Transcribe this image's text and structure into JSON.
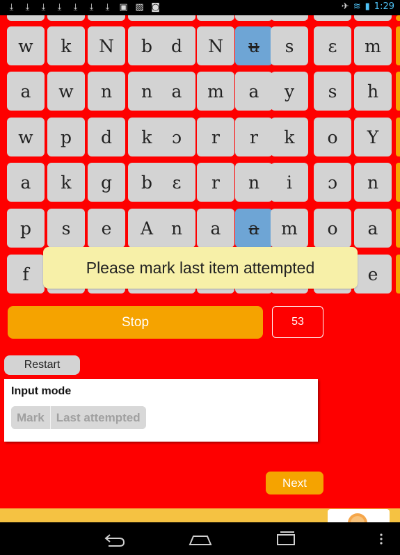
{
  "status_bar": {
    "time": "1:29",
    "left_icons": [
      "download-icon",
      "download-icon",
      "download-icon",
      "download-icon",
      "download-icon",
      "download-icon",
      "download-icon",
      "clipboard-icon",
      "gallery-icon",
      "camera-icon"
    ],
    "right_icons": [
      "bluetooth-icon",
      "wifi-icon",
      "battery-icon"
    ]
  },
  "grid": {
    "rows": [
      [
        "w",
        "k",
        "N",
        "b",
        "d",
        "N",
        "ʉ",
        "s",
        "ɛ",
        "m"
      ],
      [
        "a",
        "w",
        "n",
        "n",
        "a",
        "m",
        "a",
        "y",
        "s",
        "h"
      ],
      [
        "w",
        "p",
        "d",
        "k",
        "ɔ",
        "r",
        "r",
        "k",
        "o",
        "Y"
      ],
      [
        "a",
        "k",
        "g",
        "b",
        "ɛ",
        "r",
        "n",
        "i",
        "ɔ",
        "n"
      ],
      [
        "p",
        "s",
        "e",
        "A",
        "n",
        "a",
        "a",
        "m",
        "o",
        "a"
      ],
      [
        "f",
        "",
        "",
        "",
        "",
        "",
        "",
        "",
        "",
        "e"
      ]
    ],
    "selected": [
      [
        0,
        6
      ],
      [
        4,
        6
      ]
    ],
    "struck": [
      [
        0,
        6
      ],
      [
        4,
        6
      ]
    ]
  },
  "tooltip": "Please mark last item attempted",
  "controls": {
    "stop_label": "Stop",
    "counter": "53",
    "restart_label": "Restart",
    "next_label": "Next"
  },
  "input_mode": {
    "title": "Input mode",
    "options": [
      "Mark",
      "Last attempted"
    ]
  },
  "colors": {
    "background": "#fe0000",
    "accent": "#f5a300",
    "cell": "#d3d3d3",
    "selected_cell": "#6ea5d5",
    "tooltip": "#f7f0a8"
  }
}
